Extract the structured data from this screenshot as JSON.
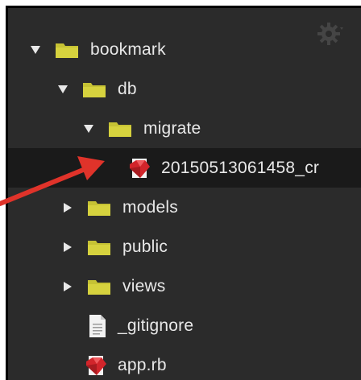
{
  "tree": {
    "items": [
      {
        "label": "bookmark",
        "kind": "folder",
        "expanded": true
      },
      {
        "label": "db",
        "kind": "folder",
        "expanded": true
      },
      {
        "label": "migrate",
        "kind": "folder",
        "expanded": true
      },
      {
        "label": "20150513061458_cr",
        "kind": "ruby-file",
        "selected": true
      },
      {
        "label": "models",
        "kind": "folder",
        "expanded": false
      },
      {
        "label": "public",
        "kind": "folder",
        "expanded": false
      },
      {
        "label": "views",
        "kind": "folder",
        "expanded": false
      },
      {
        "label": "_gitignore",
        "kind": "file"
      },
      {
        "label": "app.rb",
        "kind": "ruby-file"
      }
    ]
  },
  "colors": {
    "panel_bg": "#2b2b2b",
    "selected_bg": "#1a1a1a",
    "folder": "#c6c234",
    "ruby": "#d2252b",
    "arrow": "#e0332a",
    "text": "#e8e8e8"
  }
}
